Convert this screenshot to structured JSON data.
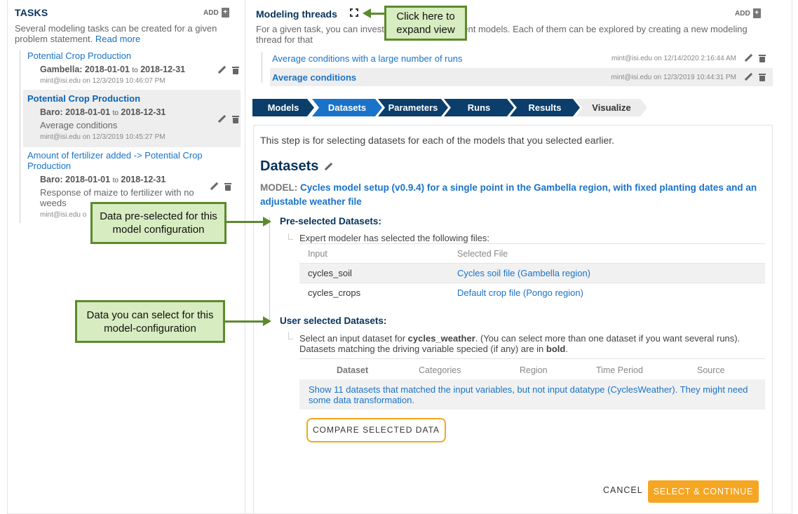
{
  "tasks": {
    "title": "TASKS",
    "add_label": "ADD",
    "description": "Several modeling tasks can be created for a given problem statement.",
    "read_more": "Read more",
    "items": [
      {
        "title": "Potential Crop Production",
        "region": "Gambella:",
        "start": "2018-01-01",
        "to": "to",
        "end": "2018-12-31",
        "subtitle": "",
        "meta": "mint@isi.edu on 12/3/2019 10:46:07 PM"
      },
      {
        "title": "Potential Crop Production",
        "region": "Baro:",
        "start": "2018-01-01",
        "to": "to",
        "end": "2018-12-31",
        "subtitle": "Average conditions",
        "meta": "mint@isi.edu on 12/3/2019 10:45:27 PM"
      },
      {
        "title": "Amount of fertilizer added -> Potential Crop Production",
        "region": "Baro:",
        "start": "2018-01-01",
        "to": "to",
        "end": "2018-12-31",
        "subtitle": "Response of maize to fertilizer with no weeds",
        "meta": "mint@isi.edu o"
      }
    ]
  },
  "threads": {
    "title": "Modeling threads",
    "add_label": "ADD",
    "description": "For a given task, you can investi  conditions or different models. Each of them can be explored by creating a new modeling thread for that",
    "items": [
      {
        "title": "Average conditions with a large number of runs",
        "meta": "mint@isi.edu on 12/14/2020 2:16:44 AM"
      },
      {
        "title": "Average conditions",
        "meta": "mint@isi.edu on 12/3/2019 10:44:31 PM"
      }
    ]
  },
  "steps": [
    "Models",
    "Datasets",
    "Parameters",
    "Runs",
    "Results",
    "Visualize"
  ],
  "main": {
    "intro": "This step is for selecting datasets for each of the models that you selected earlier.",
    "title": "Datasets",
    "model_label": "MODEL:",
    "model_name": "Cycles model setup (v0.9.4) for a single point in the Gambella region, with fixed planting dates and an adjustable weather file",
    "preselected_title": "Pre-selected Datasets:",
    "preselected_text": "Expert modeler has selected the following files:",
    "preselected_headers": [
      "Input",
      "Selected File"
    ],
    "preselected_rows": [
      {
        "input": "cycles_soil",
        "file": "Cycles soil file (Gambella region)"
      },
      {
        "input": "cycles_crops",
        "file": "Default crop file (Pongo region)"
      }
    ],
    "user_title": "User selected Datasets:",
    "user_text_1": "Select an input dataset for ",
    "user_text_bold": "cycles_weather",
    "user_text_2": ". (You can select more than one dataset if you want several runs).",
    "user_text_3": "Datasets matching the driving variable specied (if any) are in ",
    "user_text_bold2": "bold",
    "user_text_4": ".",
    "dataset_headers": [
      "Dataset",
      "Categories",
      "Region",
      "Time Period",
      "Source"
    ],
    "notice": "Show 11 datasets that matched the input variables, but not input datatype (CyclesWeather). They might need some data transformation.",
    "compare_button": "COMPARE SELECTED DATA",
    "cancel_button": "CANCEL",
    "continue_button": "SELECT & CONTINUE"
  },
  "callouts": {
    "expand": "Click here to expand view",
    "preselected": "Data pre-selected for this model configuration",
    "user": "Data you can select for this model-configuration"
  },
  "colors": {
    "accent": "#1a73c8",
    "navy": "#0b3e6a",
    "orange": "#f5a623",
    "callout_fill": "#d7ecc0",
    "callout_border": "#5c8a2c"
  }
}
